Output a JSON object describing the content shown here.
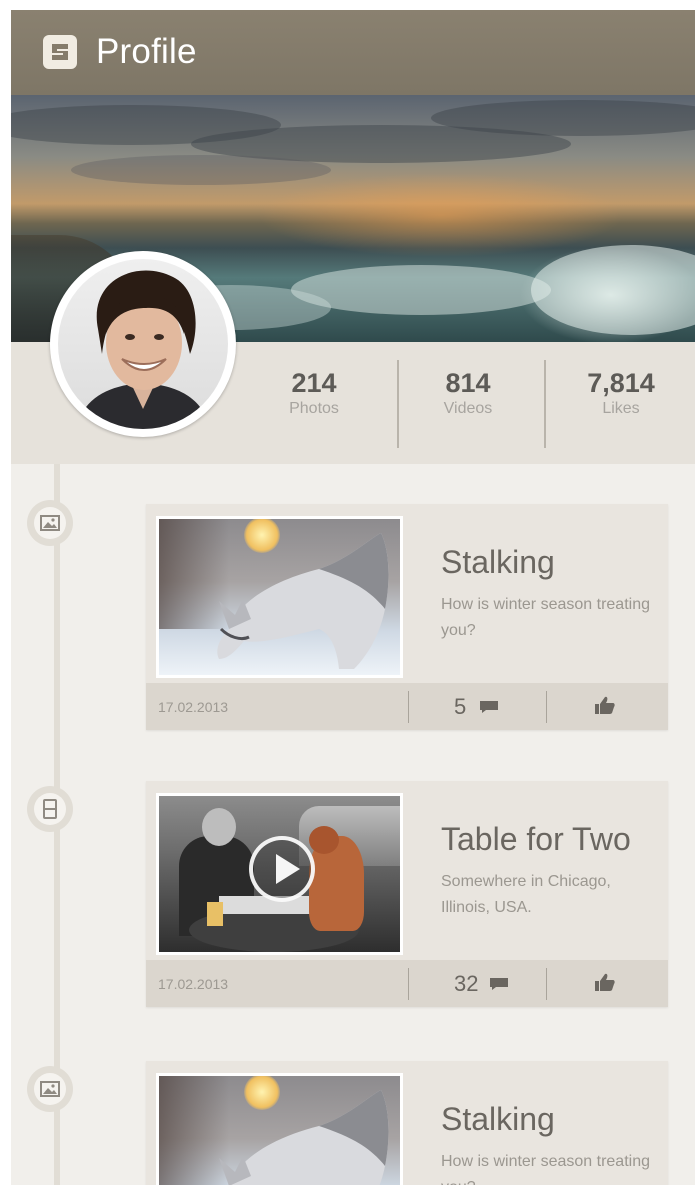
{
  "app": {
    "title": "Profile",
    "icon": "app-logo-icon"
  },
  "stats": [
    {
      "value": "214",
      "label": "Photos"
    },
    {
      "value": "814",
      "label": "Videos"
    },
    {
      "value": "7,814",
      "label": "Likes"
    }
  ],
  "posts": [
    {
      "type": "photo",
      "icon": "photo-icon",
      "title": "Stalking",
      "description": "How is winter season treating you?",
      "date": "17.02.2013",
      "comments": "5"
    },
    {
      "type": "video",
      "icon": "film-icon",
      "title": "Table for Two",
      "description": "Somewhere in Chicago, Illinois, USA.",
      "date": "17.02.2013",
      "comments": "32"
    },
    {
      "type": "photo",
      "icon": "photo-icon",
      "title": "Stalking",
      "description": "How is winter season treating you?",
      "date": "",
      "comments": ""
    }
  ],
  "colors": {
    "appbar": "#857c6b",
    "background": "#f1efeb",
    "card": "#e9e5df",
    "card_footer": "#dbd6ce",
    "text_dark": "#5d5b57"
  }
}
